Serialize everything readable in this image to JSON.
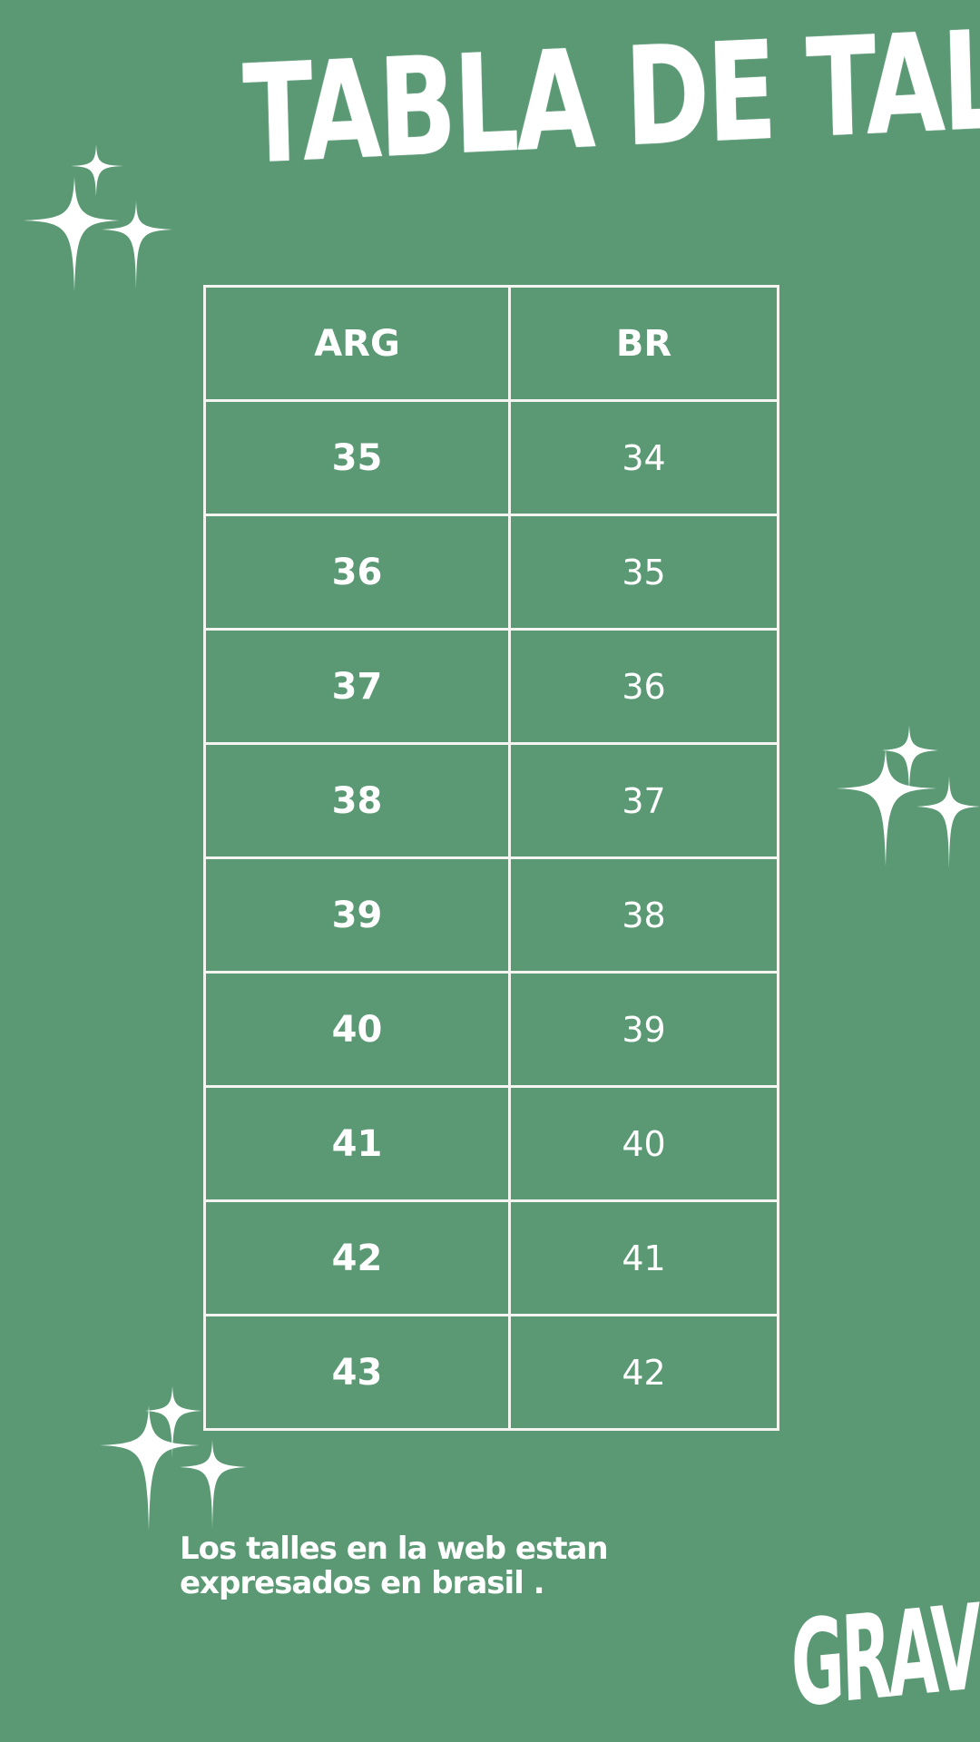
{
  "title": "TABLA DE TALLES",
  "table": {
    "headers": [
      "ARG",
      "BR"
    ],
    "rows": [
      [
        "35",
        "34"
      ],
      [
        "36",
        "35"
      ],
      [
        "37",
        "36"
      ],
      [
        "38",
        "37"
      ],
      [
        "39",
        "38"
      ],
      [
        "40",
        "39"
      ],
      [
        "41",
        "40"
      ],
      [
        "42",
        "41"
      ],
      [
        "43",
        "42"
      ]
    ]
  },
  "note": "Los talles en la web estan expresados en brasil .",
  "brand": "GRAV",
  "colors": {
    "background": "#5b9975",
    "foreground": "#ffffff"
  },
  "decorations": [
    "sparkle-icon"
  ]
}
